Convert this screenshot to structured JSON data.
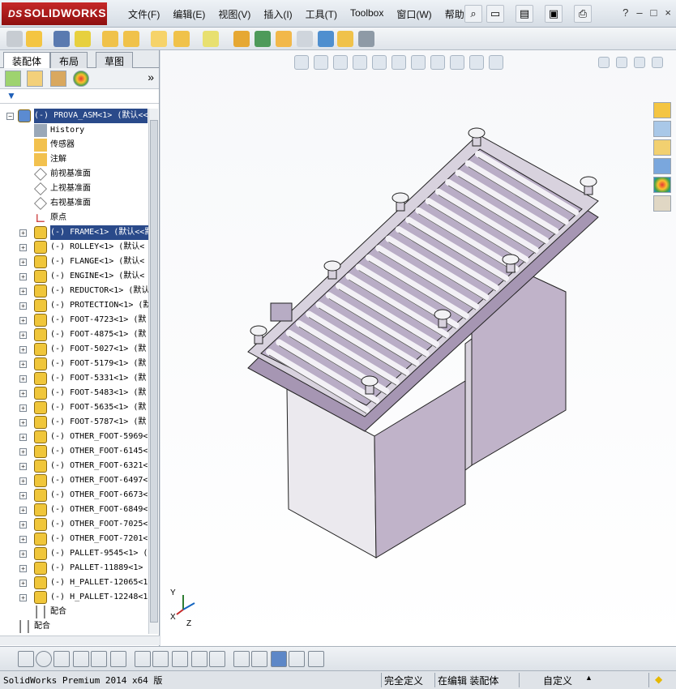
{
  "app": {
    "logo_text": "SOLIDWORKS",
    "logo_prefix": "DS"
  },
  "menu": [
    "文件(F)",
    "编辑(E)",
    "视图(V)",
    "插入(I)",
    "工具(T)",
    "Toolbox",
    "窗口(W)",
    "帮助(H)"
  ],
  "window_controls": {
    "help": "?",
    "minimize": "–",
    "restore": "□",
    "close": "×"
  },
  "panel": {
    "tabs": [
      "装配体",
      "布局",
      "草图"
    ],
    "expand_arrow": "»"
  },
  "tree": [
    {
      "label": "(-) PROVA_ASM<1> (默认<<",
      "level": 0,
      "selected": true,
      "icon": "assembly-icon",
      "expander": "−"
    },
    {
      "label": "History",
      "level": 1,
      "icon": "history-icon"
    },
    {
      "label": "传感器",
      "level": 1,
      "icon": "sensor-icon"
    },
    {
      "label": "注解",
      "level": 1,
      "icon": "annotation-icon"
    },
    {
      "label": "前视基准面",
      "level": 1,
      "icon": "plane-icon"
    },
    {
      "label": "上视基准面",
      "level": 1,
      "icon": "plane-icon"
    },
    {
      "label": "右视基准面",
      "level": 1,
      "icon": "plane-icon"
    },
    {
      "label": "原点",
      "level": 1,
      "icon": "origin-icon"
    },
    {
      "label": "(-) FRAME<1> (默认<<默",
      "level": 1,
      "selected": true,
      "icon": "part-icon",
      "expander": "+"
    },
    {
      "label": "(-) ROLLEY<1> (默认<",
      "level": 1,
      "icon": "part-icon",
      "expander": "+"
    },
    {
      "label": "(-) FLANGE<1> (默认<",
      "level": 1,
      "icon": "part-icon",
      "expander": "+"
    },
    {
      "label": "(-) ENGINE<1> (默认<",
      "level": 1,
      "icon": "part-icon",
      "expander": "+"
    },
    {
      "label": "(-) REDUCTOR<1> (默认",
      "level": 1,
      "icon": "part-icon",
      "expander": "+"
    },
    {
      "label": "(-) PROTECTION<1> (默",
      "level": 1,
      "icon": "part-icon",
      "expander": "+"
    },
    {
      "label": "(-) FOOT-4723<1> (默",
      "level": 1,
      "icon": "part-icon",
      "expander": "+"
    },
    {
      "label": "(-) FOOT-4875<1> (默",
      "level": 1,
      "icon": "part-icon",
      "expander": "+"
    },
    {
      "label": "(-) FOOT-5027<1> (默",
      "level": 1,
      "icon": "part-icon",
      "expander": "+"
    },
    {
      "label": "(-) FOOT-5179<1> (默",
      "level": 1,
      "icon": "part-icon",
      "expander": "+"
    },
    {
      "label": "(-) FOOT-5331<1> (默",
      "level": 1,
      "icon": "part-icon",
      "expander": "+"
    },
    {
      "label": "(-) FOOT-5483<1> (默",
      "level": 1,
      "icon": "part-icon",
      "expander": "+"
    },
    {
      "label": "(-) FOOT-5635<1> (默",
      "level": 1,
      "icon": "part-icon",
      "expander": "+"
    },
    {
      "label": "(-) FOOT-5787<1> (默",
      "level": 1,
      "icon": "part-icon",
      "expander": "+"
    },
    {
      "label": "(-) OTHER_FOOT-5969<",
      "level": 1,
      "icon": "part-icon",
      "expander": "+"
    },
    {
      "label": "(-) OTHER_FOOT-6145<",
      "level": 1,
      "icon": "part-icon",
      "expander": "+"
    },
    {
      "label": "(-) OTHER_FOOT-6321<",
      "level": 1,
      "icon": "part-icon",
      "expander": "+"
    },
    {
      "label": "(-) OTHER_FOOT-6497<",
      "level": 1,
      "icon": "part-icon",
      "expander": "+"
    },
    {
      "label": "(-) OTHER_FOOT-6673<",
      "level": 1,
      "icon": "part-icon",
      "expander": "+"
    },
    {
      "label": "(-) OTHER_FOOT-6849<",
      "level": 1,
      "icon": "part-icon",
      "expander": "+"
    },
    {
      "label": "(-) OTHER_FOOT-7025<",
      "level": 1,
      "icon": "part-icon",
      "expander": "+"
    },
    {
      "label": "(-) OTHER_FOOT-7201<",
      "level": 1,
      "icon": "part-icon",
      "expander": "+"
    },
    {
      "label": "(-) PALLET-9545<1> (",
      "level": 1,
      "icon": "part-icon",
      "expander": "+"
    },
    {
      "label": "(-) PALLET-11889<1>",
      "level": 1,
      "icon": "part-icon",
      "expander": "+"
    },
    {
      "label": "(-) H_PALLET-12065<1",
      "level": 1,
      "icon": "part-icon",
      "expander": "+"
    },
    {
      "label": "(-) H_PALLET-12248<1",
      "level": 1,
      "icon": "part-icon",
      "expander": "+"
    },
    {
      "label": "配合",
      "level": 1,
      "icon": "mates-icon"
    },
    {
      "label": "配合",
      "level": 0,
      "icon": "mates-icon"
    }
  ],
  "triad": {
    "x": "X",
    "y": "Y",
    "z": "Z"
  },
  "status": {
    "app": "SolidWorks Premium 2014 x64 版",
    "definition": "完全定义",
    "mode": "在编辑 装配体",
    "units": "自定义",
    "arrow": "▲"
  },
  "colors": {
    "accent": "#2a4a8a",
    "logo": "#b01e1e",
    "model_side": "#c0b3c9",
    "model_front": "#ebe9ee"
  }
}
